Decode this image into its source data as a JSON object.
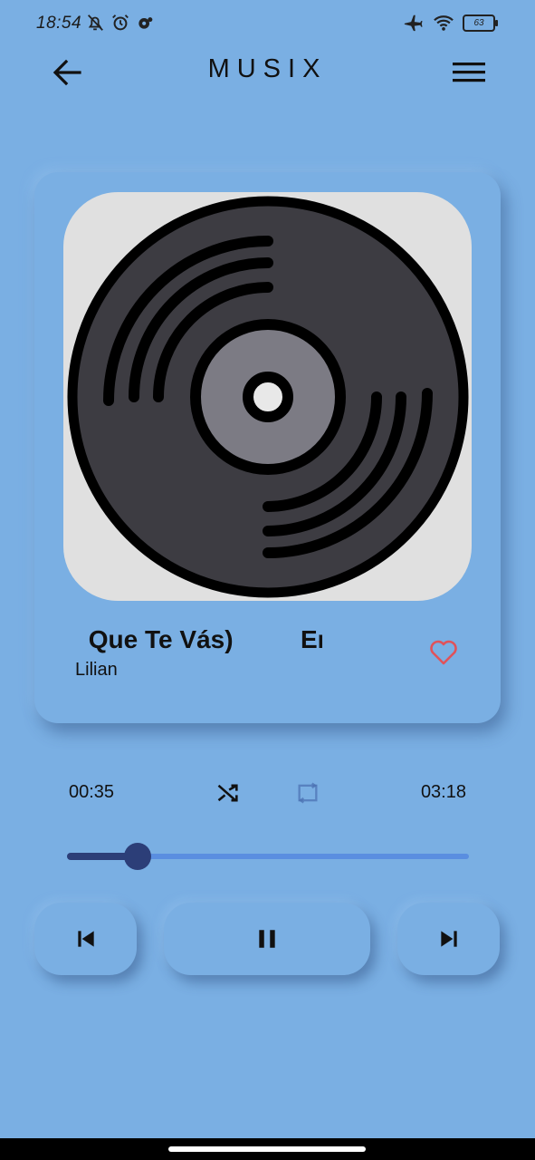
{
  "status_bar": {
    "time": "18:54",
    "battery": "63",
    "icons": [
      "bell-off-icon",
      "alarm-icon",
      "app-icon",
      "airplane-icon",
      "wifi-icon",
      "battery-icon"
    ]
  },
  "app_bar": {
    "title": "MUSIX",
    "icons": [
      "back-arrow-icon",
      "menu-icon"
    ]
  },
  "now_playing": {
    "artwork_icon": "vinyl-record-icon",
    "title_visible": " Que Te Vás)",
    "title_next_visible": "En",
    "artist": "Lilian",
    "favorite_icon": "heart-outline-icon"
  },
  "playback": {
    "current_time": "00:35",
    "total_time": "03:18",
    "progress_fraction": 0.176,
    "shuffle_icon": "shuffle-icon",
    "repeat_icon": "repeat-icon"
  },
  "controls": {
    "icons": [
      "skip-previous-icon",
      "pause-icon",
      "skip-next-icon"
    ]
  },
  "colors": {
    "background": "#7aafe3",
    "accent": "#2c3e78",
    "track": "#5a8ee0",
    "heart": "#e0525a"
  }
}
